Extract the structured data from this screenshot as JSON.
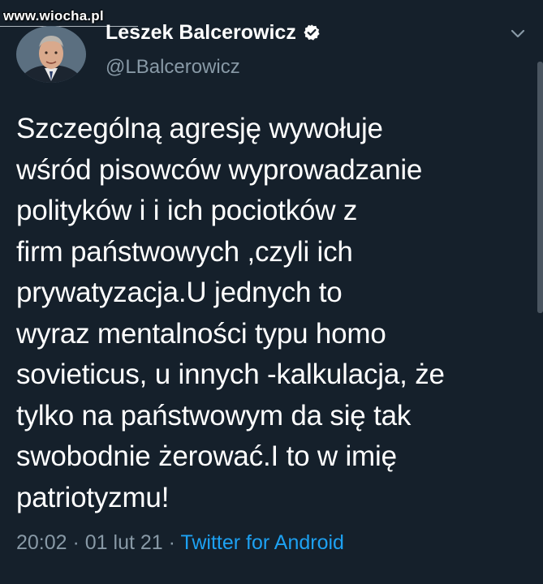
{
  "watermark": "www.wiocha.pl",
  "tweet": {
    "author_name": "Leszek Balcerowicz",
    "author_handle": "@LBalcerowicz",
    "text_lines": [
      "Szczególną agresję wywołuje",
      "wśród pisowców wyprowadzanie",
      "polityków i i ich pociotków z",
      "firm państwowych ,czyli ich",
      "prywatyzacja.U jednych to",
      "wyraz mentalności typu homo",
      "sovieticus, u innych -kalkulacja, że",
      "tylko na państwowym da się tak",
      "swobodnie żerować.I to w imię",
      "patriotyzmu!"
    ],
    "time": "20:02",
    "separator": " · ",
    "date": "01 lut 21",
    "source": "Twitter for Android"
  },
  "icons": {
    "verified": "verified-badge-icon",
    "more": "chevron-down-icon"
  },
  "colors": {
    "background": "#15202b",
    "secondary_text": "#8899a6",
    "link": "#1da1f2"
  }
}
